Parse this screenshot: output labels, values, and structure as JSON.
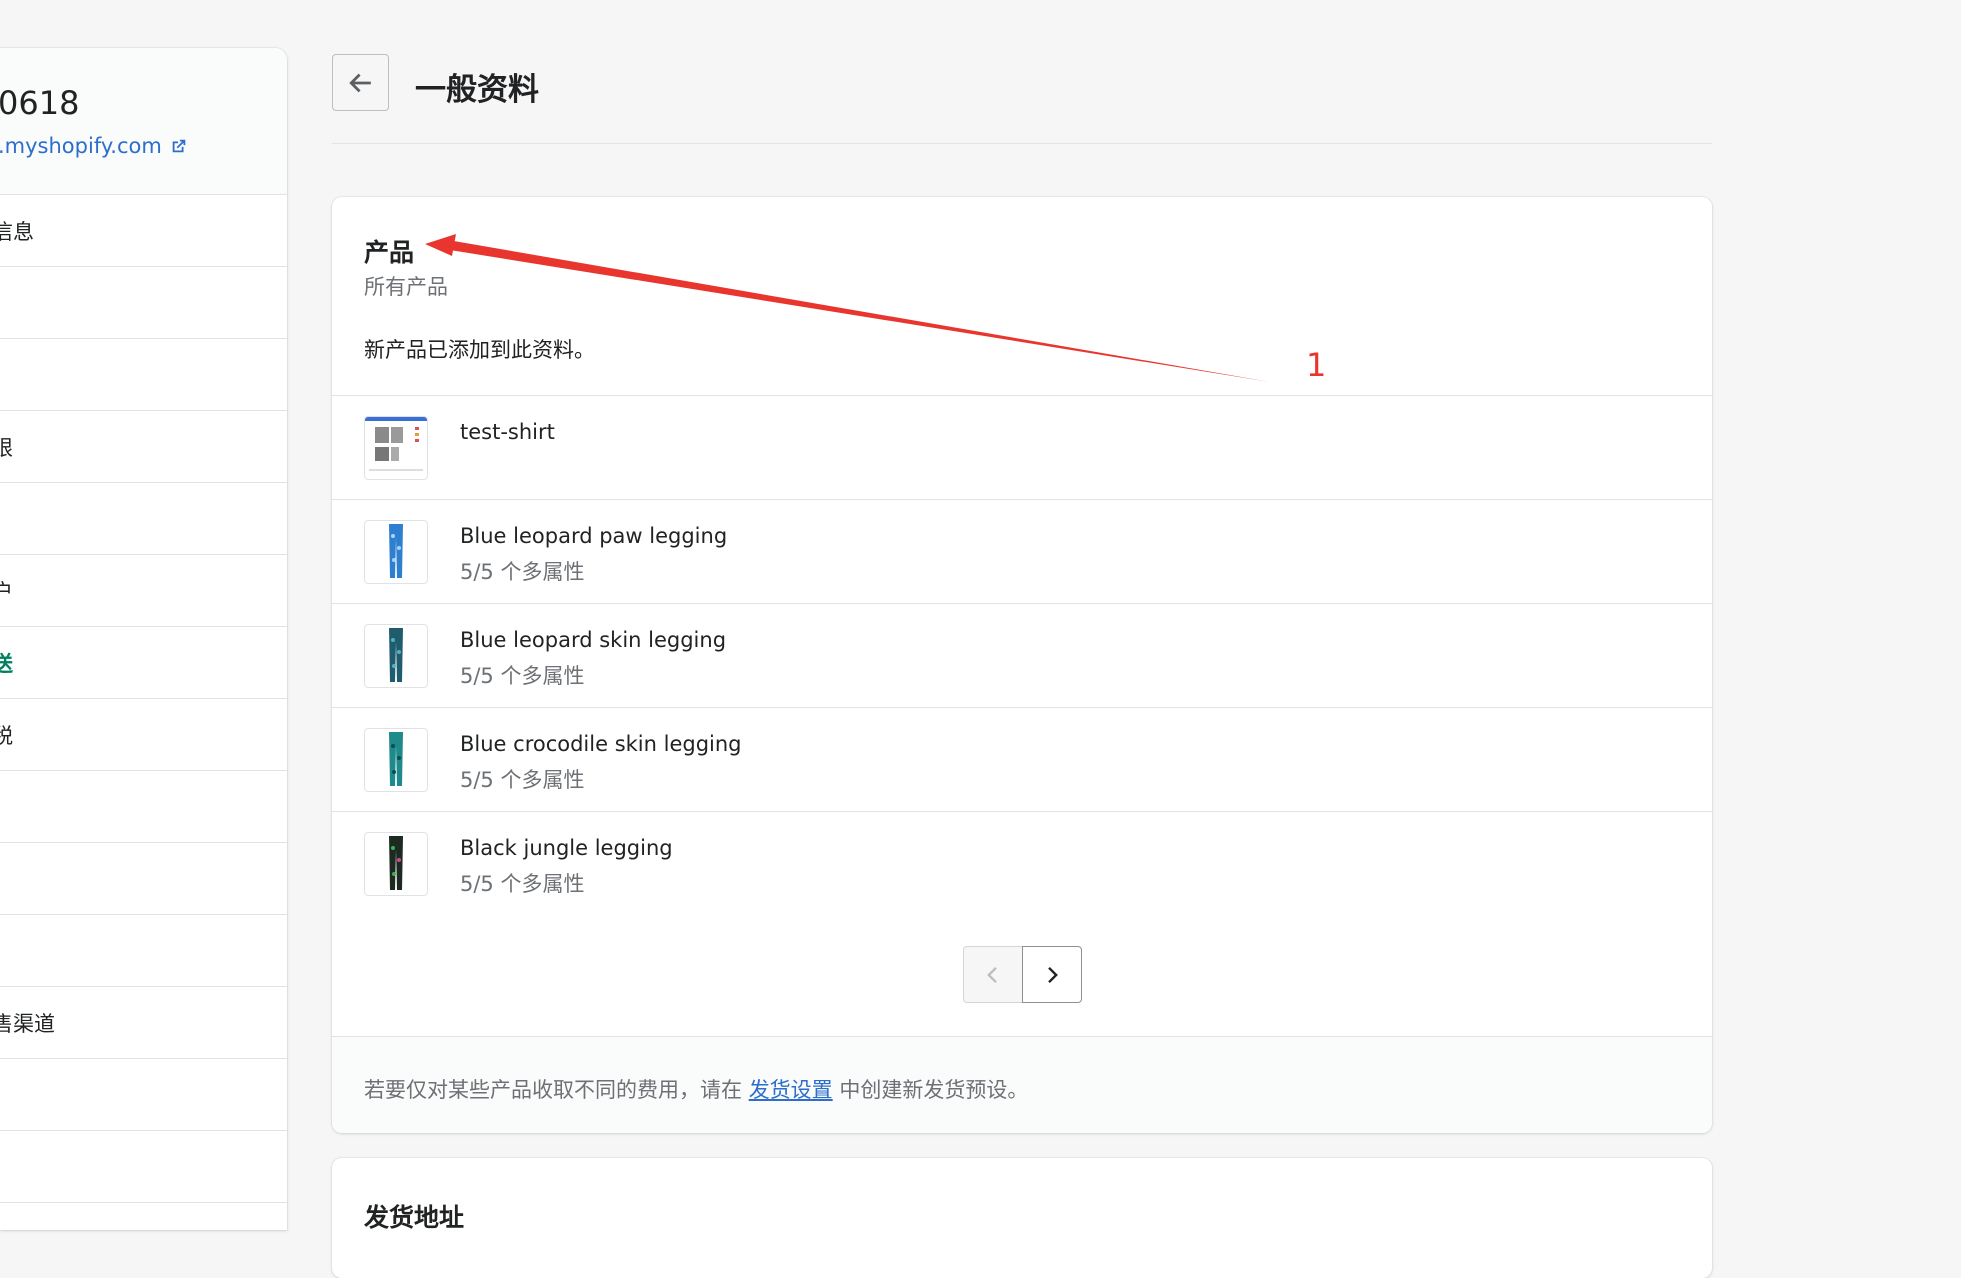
{
  "sidebar": {
    "store_name": "0618",
    "store_url": ".myshopify.com",
    "items": [
      {
        "label": "信息"
      },
      {
        "label": ""
      },
      {
        "label": ""
      },
      {
        "label": "限"
      },
      {
        "label": ""
      },
      {
        "label": "户"
      },
      {
        "label": "送",
        "active": true
      },
      {
        "label": "税"
      },
      {
        "label": ""
      },
      {
        "label": ""
      },
      {
        "label": ""
      },
      {
        "label": "售渠道"
      },
      {
        "label": ""
      },
      {
        "label": ""
      }
    ]
  },
  "header": {
    "title": "一般资料"
  },
  "products_card": {
    "title": "产品",
    "subtitle": "所有产品",
    "note": "新产品已添加到此资料。",
    "products": [
      {
        "name": "test-shirt",
        "variants": ""
      },
      {
        "name": "Blue leopard paw legging",
        "variants": "5/5 个多属性"
      },
      {
        "name": "Blue leopard skin legging",
        "variants": "5/5 个多属性"
      },
      {
        "name": "Blue crocodile skin legging",
        "variants": "5/5 个多属性"
      },
      {
        "name": "Black jungle legging",
        "variants": "5/5 个多属性"
      }
    ],
    "footer_prefix": "若要仅对某些产品收取不同的费用，请在 ",
    "footer_link": "发货设置",
    "footer_suffix": " 中创建新发货预设。"
  },
  "address_card": {
    "title": "发货地址"
  },
  "annotation": {
    "label": "1",
    "color": "#e8362f"
  }
}
